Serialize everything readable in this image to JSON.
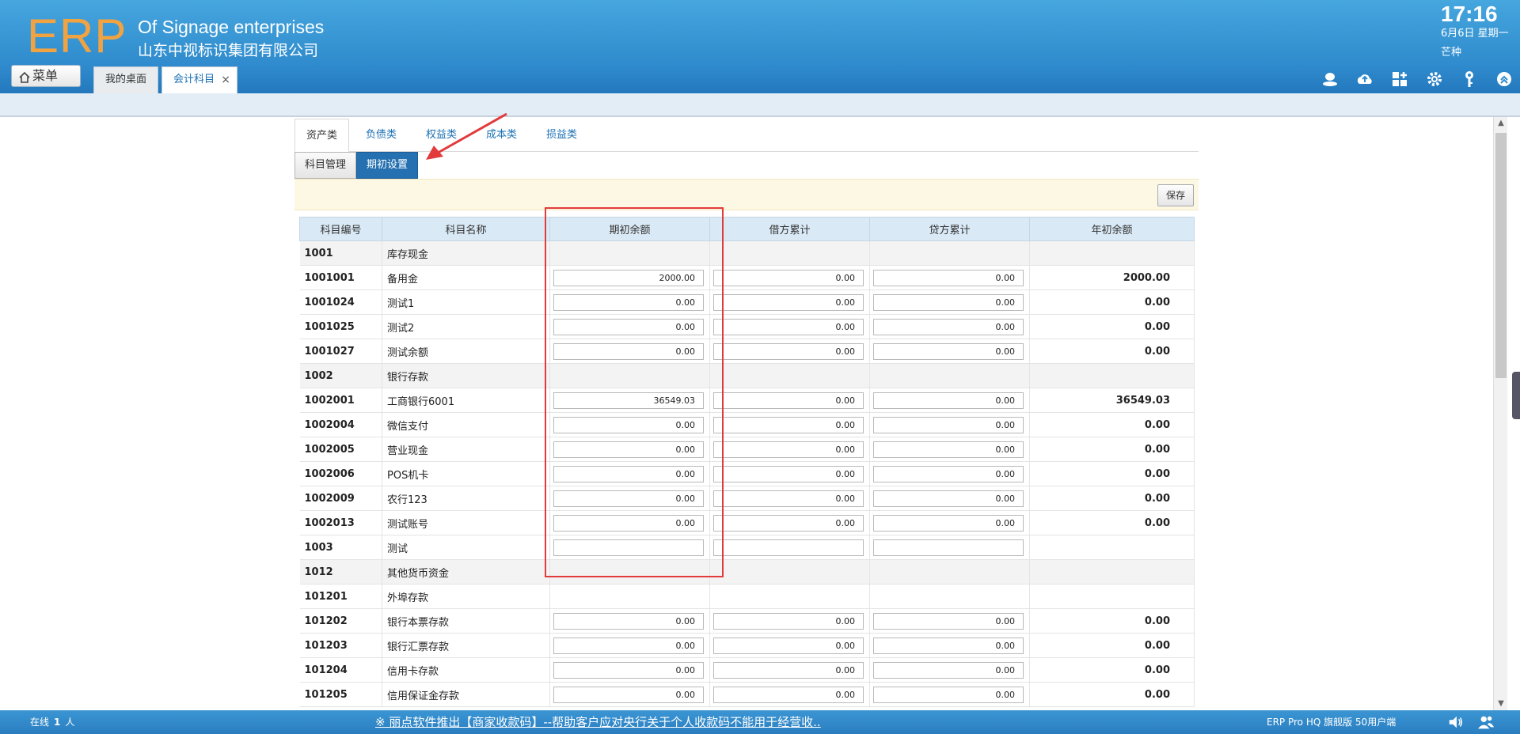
{
  "header": {
    "logo": "ERP",
    "company_en": "Of Signage enterprises",
    "company_cn": "山东中视标识集团有限公司",
    "clock": "17:16",
    "date": "6月6日 星期一",
    "solar_term": "芒种",
    "menu_label": "菜单",
    "tabs": [
      {
        "label": "我的桌面"
      },
      {
        "label": "会计科目",
        "close": "×"
      }
    ]
  },
  "account_types": [
    "资产类",
    "负债类",
    "权益类",
    "成本类",
    "损益类"
  ],
  "modes": [
    "科目管理",
    "期初设置"
  ],
  "toolbar": {
    "save_label": "保存"
  },
  "columns": [
    "科目编号",
    "科目名称",
    "期初余额",
    "借方累计",
    "贷方累计",
    "年初余额"
  ],
  "rows": [
    {
      "code": "1001",
      "name": "库存现金",
      "group": true
    },
    {
      "code": "1001001",
      "name": "备用金",
      "opening": "2000.00",
      "debit": "0.00",
      "credit": "0.00",
      "year": "2000.00"
    },
    {
      "code": "1001024",
      "name": "测试1",
      "opening": "0.00",
      "debit": "0.00",
      "credit": "0.00",
      "year": "0.00"
    },
    {
      "code": "1001025",
      "name": "测试2",
      "opening": "0.00",
      "debit": "0.00",
      "credit": "0.00",
      "year": "0.00"
    },
    {
      "code": "1001027",
      "name": "测试余额",
      "opening": "0.00",
      "debit": "0.00",
      "credit": "0.00",
      "year": "0.00"
    },
    {
      "code": "1002",
      "name": "银行存款",
      "group": true
    },
    {
      "code": "1002001",
      "name": "工商银行6001",
      "opening": "36549.03",
      "debit": "0.00",
      "credit": "0.00",
      "year": "36549.03"
    },
    {
      "code": "1002004",
      "name": "微信支付",
      "opening": "0.00",
      "debit": "0.00",
      "credit": "0.00",
      "year": "0.00"
    },
    {
      "code": "1002005",
      "name": "营业现金",
      "opening": "0.00",
      "debit": "0.00",
      "credit": "0.00",
      "year": "0.00"
    },
    {
      "code": "1002006",
      "name": "POS机卡",
      "opening": "0.00",
      "debit": "0.00",
      "credit": "0.00",
      "year": "0.00"
    },
    {
      "code": "1002009",
      "name": "农行123",
      "opening": "0.00",
      "debit": "0.00",
      "credit": "0.00",
      "year": "0.00"
    },
    {
      "code": "1002013",
      "name": "测试账号",
      "opening": "0.00",
      "debit": "0.00",
      "credit": "0.00",
      "year": "0.00"
    },
    {
      "code": "1003",
      "name": "测试",
      "opening": "",
      "debit": "",
      "credit": "",
      "year": ""
    },
    {
      "code": "1012",
      "name": "其他货币资金",
      "group": true
    },
    {
      "code": "101201",
      "name": "外埠存款",
      "plain": true
    },
    {
      "code": "101202",
      "name": "银行本票存款",
      "opening": "0.00",
      "debit": "0.00",
      "credit": "0.00",
      "year": "0.00"
    },
    {
      "code": "101203",
      "name": "银行汇票存款",
      "opening": "0.00",
      "debit": "0.00",
      "credit": "0.00",
      "year": "0.00"
    },
    {
      "code": "101204",
      "name": "信用卡存款",
      "opening": "0.00",
      "debit": "0.00",
      "credit": "0.00",
      "year": "0.00"
    },
    {
      "code": "101205",
      "name": "信用保证金存款",
      "opening": "0.00",
      "debit": "0.00",
      "credit": "0.00",
      "year": "0.00"
    }
  ],
  "footer": {
    "online_label": "在线",
    "online_count": "1",
    "online_unit": "人",
    "marquee": "※ 丽点软件推出【商家收款码】--帮助客户应对央行关于个人收款码不能用于经营收..",
    "version": "ERP Pro HQ 旗舰版 50用户端"
  },
  "colors": {
    "header": "#2f8bcd",
    "logo": "#f2a341",
    "accent": "#2470b0",
    "highlight": "#e23b3b"
  }
}
